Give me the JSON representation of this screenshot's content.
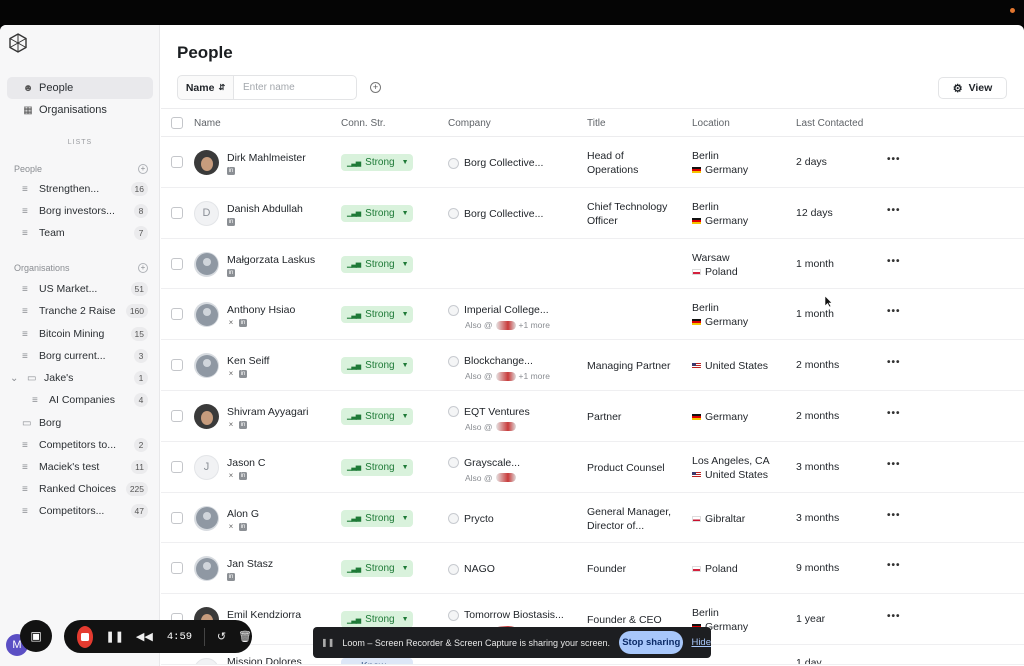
{
  "sidebar": {
    "nav": [
      {
        "label": "People",
        "icon": "people-icon",
        "active": true
      },
      {
        "label": "Organisations",
        "icon": "building-icon",
        "active": false
      }
    ],
    "lists_header": "LISTS",
    "people_section": "People",
    "people_lists": [
      {
        "label": "Strengthen...",
        "count": "16"
      },
      {
        "label": "Borg investors...",
        "count": "8"
      },
      {
        "label": "Team",
        "count": "7"
      }
    ],
    "org_section": "Organisations",
    "org_lists": [
      {
        "label": "US Market...",
        "count": "51"
      },
      {
        "label": "Tranche 2 Raise",
        "count": "160"
      },
      {
        "label": "Bitcoin Mining",
        "count": "15"
      },
      {
        "label": "Borg current...",
        "count": "3"
      },
      {
        "label": "Jake's",
        "count": "1"
      },
      {
        "label": "AI Companies",
        "count": "4"
      },
      {
        "label": "Borg",
        "count": ""
      },
      {
        "label": "Competitors to...",
        "count": "2"
      },
      {
        "label": "Maciek's test",
        "count": "11"
      },
      {
        "label": "Ranked Choices",
        "count": "225"
      },
      {
        "label": "Competitors...",
        "count": "47"
      }
    ]
  },
  "header": {
    "title": "People",
    "filter_field": "Name",
    "filter_placeholder": "Enter name",
    "view_label": "View"
  },
  "columns": [
    "Name",
    "Conn. Str.",
    "Company",
    "Title",
    "Location",
    "Last Contacted"
  ],
  "rows": [
    {
      "name": "Dirk Mahlmeister",
      "avatar": "photo",
      "strength": "Strong",
      "company": "Borg Collective...",
      "also": "",
      "title": [
        "Head of",
        "Operations"
      ],
      "location": [
        "Berlin",
        "Germany"
      ],
      "flag": "de",
      "last": "2 days"
    },
    {
      "name": "Danish Abdullah",
      "avatar": "D",
      "strength": "Strong",
      "company": "Borg Collective...",
      "also": "",
      "title": [
        "Chief Technology",
        "Officer"
      ],
      "location": [
        "Berlin",
        "Germany"
      ],
      "flag": "de",
      "last": "12 days"
    },
    {
      "name": "Małgorzata Laskus",
      "avatar": "ph",
      "strength": "Strong",
      "company": "",
      "also": "",
      "title": [],
      "location": [
        "Warsaw",
        "Poland"
      ],
      "flag": "pl",
      "last": "1 month"
    },
    {
      "name": "Anthony Hsiao",
      "avatar": "ph",
      "strength": "Strong",
      "company": "Imperial College...",
      "also": "+1 more",
      "title": [],
      "location": [
        "Berlin",
        "Germany"
      ],
      "flag": "de",
      "last": "1 month"
    },
    {
      "name": "Ken Seiff",
      "avatar": "ph",
      "strength": "Strong",
      "company": "Blockchange...",
      "also": "+1 more",
      "title": [
        "Managing Partner"
      ],
      "location": [
        "United States"
      ],
      "flag": "us",
      "last": "2 months"
    },
    {
      "name": "Shivram Ayyagari",
      "avatar": "photo",
      "strength": "Strong",
      "company": "EQT Ventures",
      "also": " ",
      "title": [
        "Partner"
      ],
      "location": [
        "Germany"
      ],
      "flag": "de",
      "last": "2 months"
    },
    {
      "name": "Jason C",
      "avatar": "J",
      "strength": "Strong",
      "company": "Grayscale...",
      "also": " ",
      "title": [
        "Product Counsel"
      ],
      "location": [
        "Los Angeles, CA",
        "United States"
      ],
      "flag": "us",
      "last": "3 months"
    },
    {
      "name": "Alon G",
      "avatar": "ph",
      "strength": "Strong",
      "company": "Prycto",
      "also": "",
      "title": [
        "General Manager,",
        "Director of..."
      ],
      "location": [
        "Gibraltar"
      ],
      "flag": "gi",
      "last": "3 months"
    },
    {
      "name": "Jan Stasz",
      "avatar": "ph",
      "strength": "Strong",
      "company": "NAGO",
      "also": "",
      "title": [
        "Founder"
      ],
      "location": [
        "Poland"
      ],
      "flag": "pl",
      "last": "9 months"
    },
    {
      "name": "Emil Kendziorra",
      "avatar": "photo",
      "strength": "Strong",
      "company": "Tomorrow Biostasis...",
      "also": " ",
      "title": [
        "Founder & CEO"
      ],
      "location": [
        "Berlin",
        "Germany"
      ],
      "flag": "de",
      "last": "1 year"
    }
  ],
  "partial_row": {
    "avatar": "M",
    "name": "Mission Dolores",
    "strength": "Know",
    "last": "1 day"
  },
  "also_label": "Also @",
  "recorder": {
    "time": "4:59",
    "user_initial": "M"
  },
  "share_bar": {
    "text": "Loom – Screen Recorder & Screen Capture is sharing your screen.",
    "stop": "Stop sharing",
    "hide": "Hide"
  },
  "colors": {
    "strong_bg": "#d9f2dc",
    "strong_fg": "#1e7a37",
    "record": "#e53b30",
    "stop_share": "#a8c7fa"
  }
}
